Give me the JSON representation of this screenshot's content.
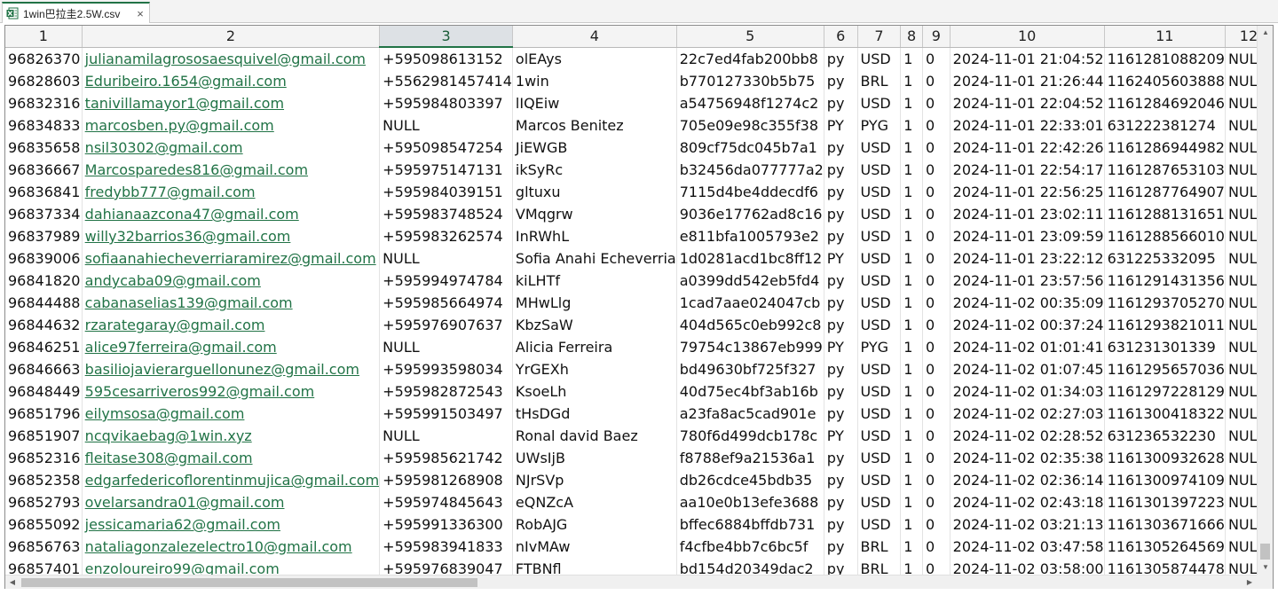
{
  "tab": {
    "title": "1win巴拉圭2.5W.csv",
    "close_glyph": "×",
    "icon": "excel-csv-icon",
    "accent": "#217346"
  },
  "columns": [
    "1",
    "2",
    "3",
    "4",
    "5",
    "6",
    "7",
    "8",
    "9",
    "10",
    "11",
    "12"
  ],
  "selected_column": 2,
  "rows": [
    [
      "96826370",
      "julianamilagrososaesquivel@gmail.com",
      "+595098613152",
      "olEAys",
      "22c7ed4fab200bb8",
      "py",
      "USD",
      "1",
      "0",
      "2024-11-01 21:04:52",
      "1161281088209",
      "NULL"
    ],
    [
      "96828603",
      "Eduribeiro.1654@gmail.com",
      "+5562981457414",
      "1win",
      "b770127330b5b75",
      "py",
      "BRL",
      "1",
      "0",
      "2024-11-01 21:26:44",
      "1162405603888",
      "NULL"
    ],
    [
      "96832316",
      "tanivillamayor1@gmail.com",
      "+595984803397",
      "lIQEiw",
      "a54756948f1274c2",
      "py",
      "USD",
      "1",
      "0",
      "2024-11-01 22:04:52",
      "1161284692046",
      "NULL"
    ],
    [
      "96834833",
      "marcosben.py@gmail.com",
      "NULL",
      "Marcos Benitez",
      "705e09e98c355f38",
      "PY",
      "PYG",
      "1",
      "0",
      "2024-11-01 22:33:01",
      "631222381274",
      "NULL"
    ],
    [
      "96835658",
      "nsil30302@gmail.com",
      "+595098547254",
      "JiEWGB",
      "809cf75dc045b7a1",
      "py",
      "USD",
      "1",
      "0",
      "2024-11-01 22:42:26",
      "1161286944982",
      "NULL"
    ],
    [
      "96836667",
      "Marcosparedes816@gmail.com",
      "+595975147131",
      "ikSyRc",
      "b32456da077777a2",
      "py",
      "USD",
      "1",
      "0",
      "2024-11-01 22:54:17",
      "1161287653103",
      "NULL"
    ],
    [
      "96836841",
      "fredybb777@gmail.com",
      "+595984039151",
      "gltuxu",
      "7115d4be4ddecdf6",
      "py",
      "USD",
      "1",
      "0",
      "2024-11-01 22:56:25",
      "1161287764907",
      "NULL"
    ],
    [
      "96837334",
      "dahianaazcona47@gmail.com",
      "+595983748524",
      "VMqgrw",
      "9036e17762ad8c16",
      "py",
      "USD",
      "1",
      "0",
      "2024-11-01 23:02:11",
      "1161288131651",
      "NULL"
    ],
    [
      "96837989",
      "willy32barrios36@gmail.com",
      "+595983262574",
      "InRWhL",
      "e811bfa1005793e2",
      "py",
      "USD",
      "1",
      "0",
      "2024-11-01 23:09:59",
      "1161288566010",
      "NULL"
    ],
    [
      "96839006",
      "sofiaanahiecheverriaramirez@gmail.com",
      "NULL",
      "Sofia Anahi Echeverria",
      "1d0281acd1bc8ff12",
      "PY",
      "USD",
      "1",
      "0",
      "2024-11-01 23:22:12",
      "631225332095",
      "NULL"
    ],
    [
      "96841820",
      "andycaba09@gmail.com",
      "+595994974784",
      "kiLHTf",
      "a0399dd542eb5fd4",
      "py",
      "USD",
      "1",
      "0",
      "2024-11-01 23:57:56",
      "1161291431356",
      "NULL"
    ],
    [
      "96844488",
      "cabanaselias139@gmail.com",
      "+595985664974",
      "MHwLlg",
      "1cad7aae024047cb",
      "py",
      "USD",
      "1",
      "0",
      "2024-11-02 00:35:09",
      "1161293705270",
      "NULL"
    ],
    [
      "96844632",
      "rzarategaray@gmail.com",
      "+595976907637",
      "KbzSaW",
      "404d565c0eb992c8",
      "py",
      "USD",
      "1",
      "0",
      "2024-11-02 00:37:24",
      "1161293821011",
      "NULL"
    ],
    [
      "96846251",
      "alice97ferreira@gmail.com",
      "NULL",
      "Alicia Ferreira",
      "79754c13867eb999",
      "PY",
      "PYG",
      "1",
      "0",
      "2024-11-02 01:01:41",
      "631231301339",
      "NULL"
    ],
    [
      "96846663",
      "basiliojavierarguellonunez@gmail.com",
      "+595993598034",
      "YrGEXh",
      "bd49630bf725f327",
      "py",
      "USD",
      "1",
      "0",
      "2024-11-02 01:07:45",
      "1161295657036",
      "NULL"
    ],
    [
      "96848449",
      "595cesarriveros992@gmail.com",
      "+595982872543",
      "KsoeLh",
      "40d75ec4bf3ab16b",
      "py",
      "USD",
      "1",
      "0",
      "2024-11-02 01:34:03",
      "1161297228129",
      "NULL"
    ],
    [
      "96851796",
      "eilymsosa@gmail.com",
      "+595991503497",
      "tHsDGd",
      "a23fa8ac5cad901e",
      "py",
      "USD",
      "1",
      "0",
      "2024-11-02 02:27:03",
      "1161300418322",
      "NULL"
    ],
    [
      "96851907",
      "ncqvikaebag@1win.xyz",
      "NULL",
      "Ronal david Baez",
      "780f6d499dcb178c",
      "PY",
      "USD",
      "1",
      "0",
      "2024-11-02 02:28:52",
      "631236532230",
      "NULL"
    ],
    [
      "96852316",
      "fleitase308@gmail.com",
      "+595985621742",
      "UWsIjB",
      "f8788ef9a21536a1",
      "py",
      "USD",
      "1",
      "0",
      "2024-11-02 02:35:38",
      "1161300932628",
      "NULL"
    ],
    [
      "96852358",
      "edgarfedericoflorentinmujica@gmail.com",
      "+595981268908",
      "NJrSVp",
      "db26cdce45bdb35",
      "py",
      "USD",
      "1",
      "0",
      "2024-11-02 02:36:14",
      "1161300974109",
      "NULL"
    ],
    [
      "96852793",
      "ovelarsandra01@gmail.com",
      "+595974845643",
      "eQNZcA",
      "aa10e0b13efe3688",
      "py",
      "USD",
      "1",
      "0",
      "2024-11-02 02:43:18",
      "1161301397223",
      "NULL"
    ],
    [
      "96855092",
      "jessicamaria62@gmail.com",
      "+595991336300",
      "RobAJG",
      "bffec6884bffdb731",
      "py",
      "USD",
      "1",
      "0",
      "2024-11-02 03:21:13",
      "1161303671666",
      "NULL"
    ],
    [
      "96856763",
      "nataliagonzalezelectro10@gmail.com",
      "+595983941833",
      "nIvMAw",
      "f4cfbe4bb7c6bc5f",
      "py",
      "BRL",
      "1",
      "0",
      "2024-11-02 03:47:58",
      "1161305264569",
      "NULL"
    ],
    [
      "96857401",
      "enzoloureiro99@gmail.com",
      "+595976839047",
      "FTBNfl",
      "bd154d20349dac2",
      "py",
      "BRL",
      "1",
      "0",
      "2024-11-02 03:58:00",
      "1161305874478",
      "NULL"
    ]
  ],
  "scrollbars": {
    "up": "▲",
    "down": "▼",
    "left": "◀",
    "right": "▶"
  }
}
